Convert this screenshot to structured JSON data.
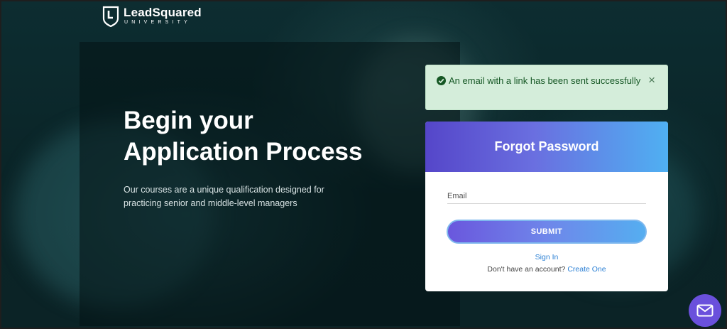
{
  "brand": {
    "name": "LeadSquared",
    "subtitle": "UNIVERSITY",
    "icon": "shield-logo-icon"
  },
  "hero": {
    "title_line1": "Begin your",
    "title_line2": "Application Process",
    "subtitle": "Our courses are a unique qualification designed for practicing senior and middle-level managers"
  },
  "alert": {
    "message": "An email with a link has been sent successfully",
    "icon": "check-circle-icon",
    "close_label": "×",
    "color": "#155724",
    "background": "#d4edda"
  },
  "form": {
    "title": "Forgot Password",
    "email_placeholder": "Email",
    "email_value": "",
    "submit_label": "SUBMIT",
    "sign_in_label": "Sign In",
    "no_account_text": "Don't have an account?",
    "create_label": "Create One"
  },
  "fab": {
    "icon": "mail-icon"
  },
  "colors": {
    "accent_start": "#5546c9",
    "accent_end": "#4fb0f2",
    "link": "#2a7fd4"
  }
}
